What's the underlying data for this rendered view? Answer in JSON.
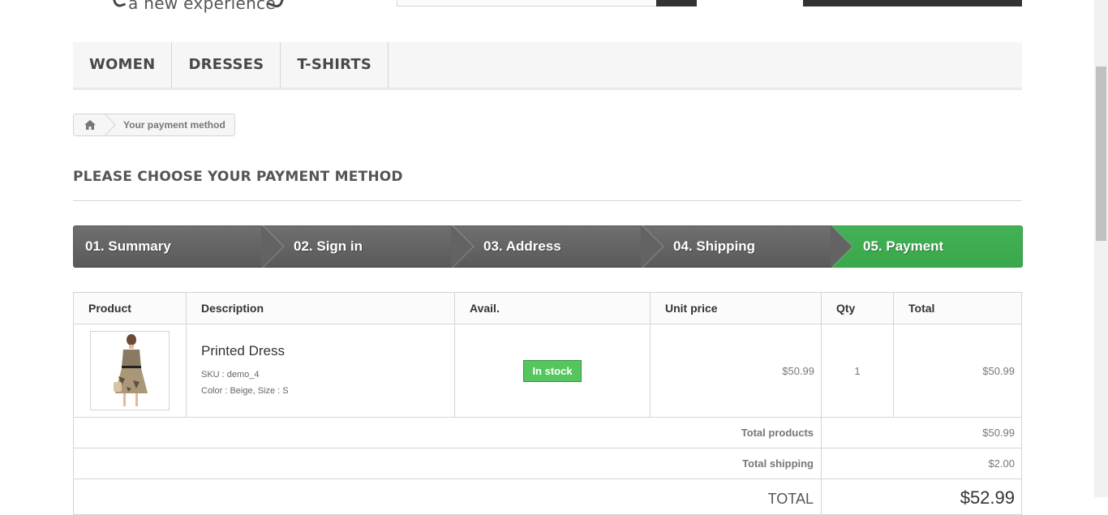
{
  "header": {
    "tagline": "a new experience"
  },
  "menu": {
    "items": [
      "WOMEN",
      "DRESSES",
      "T-SHIRTS"
    ]
  },
  "breadcrumb": {
    "current": "Your payment method"
  },
  "page": {
    "title": "PLEASE CHOOSE YOUR PAYMENT METHOD"
  },
  "steps": [
    {
      "label": "01. Summary",
      "active": false
    },
    {
      "label": "02. Sign in",
      "active": false
    },
    {
      "label": "03. Address",
      "active": false
    },
    {
      "label": "04. Shipping",
      "active": false
    },
    {
      "label": "05. Payment",
      "active": true
    }
  ],
  "cart": {
    "headers": {
      "product": "Product",
      "description": "Description",
      "avail": "Avail.",
      "unit_price": "Unit price",
      "qty": "Qty",
      "total": "Total"
    },
    "item": {
      "name": "Printed Dress",
      "sku": "SKU : demo_4",
      "attributes": "Color : Beige, Size : S",
      "availability": "In stock",
      "unit_price": "$50.99",
      "qty": "1",
      "total": "$50.99"
    },
    "totals": {
      "products_label": "Total products",
      "products_value": "$50.99",
      "shipping_label": "Total shipping",
      "shipping_value": "$2.00",
      "total_label": "TOTAL",
      "total_value": "$52.99"
    }
  },
  "colors": {
    "active_step": "#43b155",
    "step": "#666666",
    "badge": "#55c65e"
  }
}
